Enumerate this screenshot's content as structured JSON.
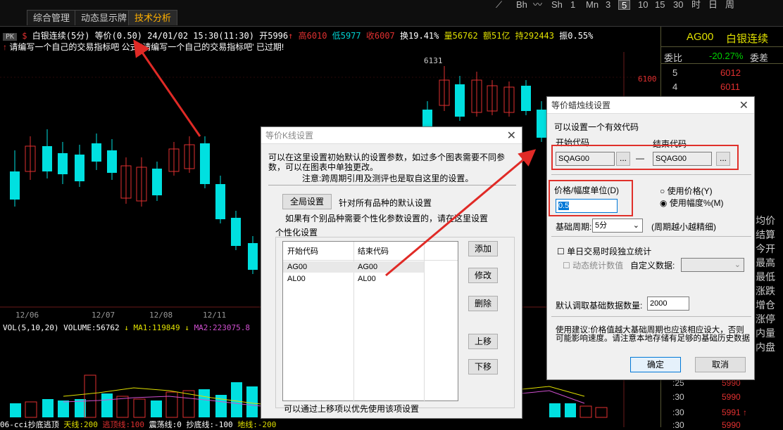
{
  "tabs": [
    {
      "label": "综合管理",
      "active": false
    },
    {
      "label": "动态显示牌",
      "active": false
    },
    {
      "label": "技术分析",
      "active": true
    }
  ],
  "periods": [
    "Bh",
    "Sh",
    "1",
    "Mn",
    "3",
    "5",
    "10",
    "15",
    "30",
    "时",
    "日",
    "周"
  ],
  "selected_period": "5",
  "info": {
    "badge": "PK",
    "symbol": "白银连续(5分)",
    "price_step": "等价(0.50)",
    "datetime": "24/01/02 15:30(11:30)",
    "open": "开5996",
    "open_arrow": "↑",
    "high": "高6010",
    "low": "低5977",
    "close": "收6007",
    "change": "换19.41%",
    "volume": "量56762",
    "amount": "额51亿",
    "hold": "持292443",
    "amplitude": "振0.55%",
    "warning": "请编写一个自己的交易指标吧  公式 '请编写一个自己的交易指标吧' 已过期!"
  },
  "chart": {
    "peak_label": "6131",
    "price_label_right": "6100",
    "date_labels": [
      "12/06",
      "12/07",
      "12/08",
      "12/11"
    ],
    "vol_line": "VOL(5,10,20) VOLUME:56762",
    "ma1": "MA1:119849",
    "ma2": "MA2:223075.8",
    "bottom_line": "06-cci抄底逃顶",
    "bottom_items": [
      "天线:200",
      "逃顶线:100",
      "震荡线:0",
      "抄底线:-100",
      "地线:-200"
    ],
    "side_nums": [
      "1",
      "1",
      "1"
    ]
  },
  "right_panel": {
    "code": "AG00",
    "name": "白银连续",
    "weibi_label": "委比",
    "weibi_value": "-20.27%",
    "weicha_label": "委差",
    "asks": [
      {
        "level": "5",
        "price": "6012"
      },
      {
        "level": "4",
        "price": "6011"
      }
    ],
    "side_labels": [
      "均价",
      "结算",
      "今开",
      "最高",
      "最低",
      "涨跌",
      "增仓",
      "涨停",
      "内量",
      "内盘"
    ],
    "ticks": [
      {
        "time": ":25",
        "price": "5990"
      },
      {
        "time": ":30",
        "price": "5990"
      },
      {
        "time": ":30",
        "price": "5991 ↑"
      },
      {
        "time": ":30",
        "price": "5990"
      }
    ]
  },
  "dlg1": {
    "title": "等价K线设置",
    "desc1": "可以在这里设置初始默认的设置参数，如过多个图表需要不同参数，可以在图表中单独更改。",
    "desc2": "注意:跨周期引用及测评也是取自这里的设置。",
    "global_btn": "全局设置",
    "global_note": "针对所有品种的默认设置",
    "personal_note": "如果有个别品种需要个性化参数设置的，请在这里设置",
    "group_label": "个性化设置",
    "col_start": "开始代码",
    "col_end": "结束代码",
    "rows": [
      {
        "start": "AG00",
        "end": "AG00"
      },
      {
        "start": "AL00",
        "end": "AL00"
      }
    ],
    "add": "添加",
    "edit": "修改",
    "delete": "删除",
    "up": "上移",
    "down": "下移",
    "footer": "可以通过上移项以优先使用该项设置"
  },
  "dlg2": {
    "title": "等价蜡烛线设置",
    "hint": "可以设置一个有效代码",
    "start_label": "开始代码",
    "end_label": "结束代码",
    "start_code": "SQAG00",
    "end_code": "SQAG00",
    "browse": "...",
    "dash": "—",
    "unit_label": "价格/幅度单位(D)",
    "unit_value": "0.5",
    "use_price": "使用价格(Y)",
    "use_amp": "使用幅度%(M)",
    "base_period_label": "基础周期:",
    "base_period_value": "5分",
    "base_period_note": "(周期越小越精细)",
    "intraday_label": "单日交易时段独立统计",
    "dynamic_label": "动态统计数值",
    "custom_label": "自定义数据:",
    "default_count_label": "默认调取基础数据数量:",
    "default_count_value": "2000",
    "advice": "使用建议:价格值越大基础周期也应该相应设大，否则可能影响速度。请注意本地存储有足够的基础历史数据",
    "ok": "确定",
    "cancel": "取消"
  }
}
